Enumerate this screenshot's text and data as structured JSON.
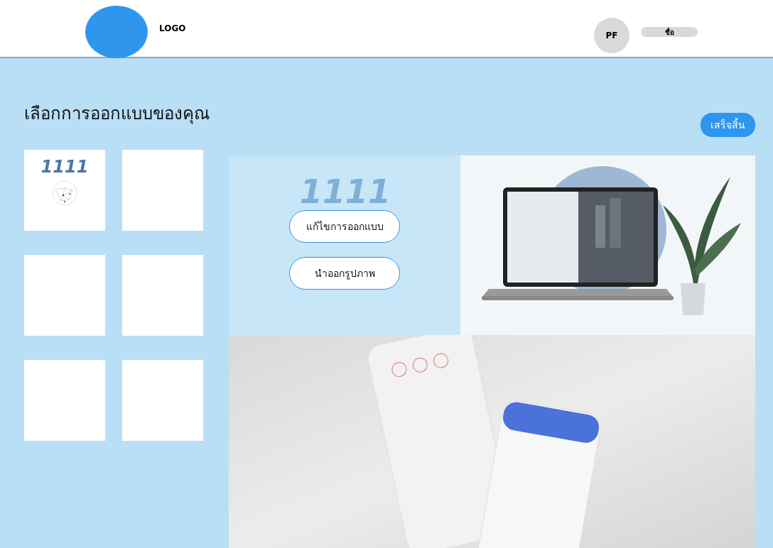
{
  "header": {
    "logo_text": "LOGO",
    "avatar_initials": "PF",
    "user_name": "ชื่อ"
  },
  "page": {
    "title": "เลือกการออกแบบของคุณ",
    "finish_button": "เสร็จสิ้น"
  },
  "design_tiles": [
    {
      "kind": "logo",
      "text": "1111"
    },
    {
      "kind": "empty"
    },
    {
      "kind": "empty"
    },
    {
      "kind": "empty"
    },
    {
      "kind": "empty"
    },
    {
      "kind": "empty"
    }
  ],
  "preview": {
    "background_text": "1111",
    "actions": [
      "แก้ไขการออกแบบ",
      "นำออกรูปภาพ"
    ]
  }
}
